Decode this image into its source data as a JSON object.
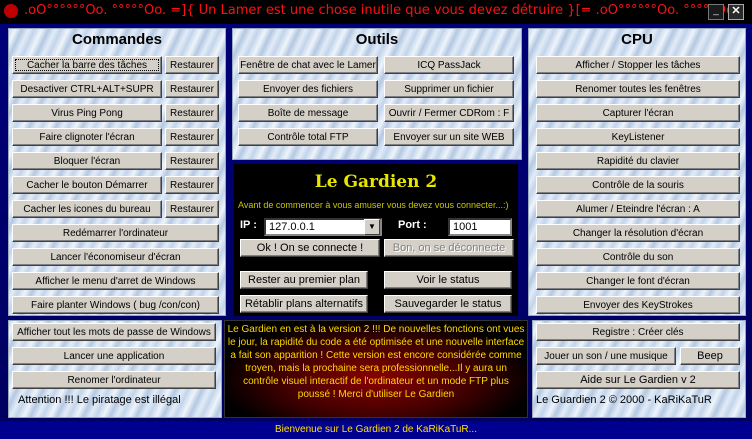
{
  "title": {
    "text": ".oO°°°°°°Oo. °°°°°Oo. =]{ Un Lamer est une chose inutile que vous devez détruire }[= .oO°°°°°°Oo. °°°°°Oo.",
    "minimize_icon": "minimize-icon",
    "close_icon": "close-icon",
    "close_glyph": "✕"
  },
  "commandes": {
    "title": "Commandes",
    "rows": [
      {
        "label": "Cacher la barre des tâches",
        "restore": "Restaurer"
      },
      {
        "label": "Desactiver CTRL+ALT+SUPR",
        "restore": "Restaurer"
      },
      {
        "label": "Virus Ping Pong",
        "restore": "Restaurer"
      },
      {
        "label": "Faire clignoter l'écran",
        "restore": "Restaurer"
      },
      {
        "label": "Bloquer l'écran",
        "restore": "Restaurer"
      },
      {
        "label": "Cacher le bouton Démarrer",
        "restore": "Restaurer"
      },
      {
        "label": "Cacher les icones du bureau",
        "restore": "Restaurer"
      }
    ],
    "wide": [
      "Redémarrer l'ordinateur",
      "Lancer l'économiseur d'écran",
      "Afficher le menu d'arret de Windows",
      "Faire planter Windows ( bug /con/con)"
    ]
  },
  "outils": {
    "title": "Outils",
    "left": [
      "Fenêtre de chat avec le Lamer",
      "Envoyer des fichiers",
      "Boîte de message",
      "Contrôle total FTP"
    ],
    "right": [
      "ICQ PassJack",
      "Supprimer un fichier",
      "Ouvrir / Fermer CDRom : F",
      "Envoyer sur un site WEB"
    ]
  },
  "gardien": {
    "title": "Le Gardien 2",
    "subtitle": "Avant de commencer à vous amuser vous devez vous connecter...:)",
    "ip_label": "IP :",
    "ip_value": "127.0.0.1",
    "port_label": "Port :",
    "port_value": "1001",
    "connect": "Ok ! On se connecte !",
    "disconnect": "Bon, on se déconnecte",
    "foreground": "Rester au premier plan",
    "status": "Voir le status",
    "restore_plans": "Rétablir plans alternatifs",
    "save_status": "Sauvegarder le status"
  },
  "cpu": {
    "title": "CPU",
    "buttons": [
      "Afficher / Stopper les tâches",
      "Renomer toutes les fenêtres",
      "Capturer l'écran",
      "KeyListener",
      "Rapidité du clavier",
      "Contrôle de la souris",
      "Alumer / Eteindre l'écran : A",
      "Changer la résolution d'écran",
      "Contrôle du son",
      "Changer le font d'écran",
      "Envoyer des KeyStrokes"
    ]
  },
  "bottom_left": {
    "buttons": [
      "Afficher tout les mots de passe de Windows",
      "Lancer une application",
      "Renomer l'ordinateur"
    ],
    "warning": "Attention !!! Le piratage est illégal"
  },
  "info": {
    "text": "Le Gardien en est à la version 2 !!! De nouvelles fonctions ont vues le jour, la rapidité du code a été optimisée et une nouvelle interface a fait son apparition ! Cette version est encore considérée comme troyen, mais la prochaine sera professionnelle...Il y aura un contrôle visuel interactif de l'ordinateur et un mode FTP plus poussé ! Merci d'utiliser Le Gardien"
  },
  "bottom_right": {
    "registre": "Registre : Créer clés",
    "sound": "Jouer un son / une musique",
    "beep": "Beep",
    "help": "Aide sur Le Gardien v 2",
    "copyright": "Le Guardien 2 © 2000 - KaRiKaTuR"
  },
  "statusbar": {
    "text": "Bienvenue sur Le Gardien 2 de KaRiKaTuR..."
  }
}
